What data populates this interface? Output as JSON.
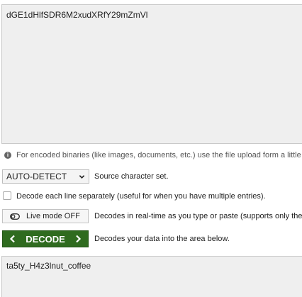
{
  "input": {
    "value": "dGE1dHlfSDR6M2xudXRfY29mZmVl"
  },
  "hint": {
    "icon": "info-icon",
    "text": "For encoded binaries (like images, documents, etc.) use the file upload form a little fu"
  },
  "charset": {
    "selected": "AUTO-DETECT",
    "label": "Source character set."
  },
  "each_line": {
    "checked": false,
    "label": "Decode each line separately (useful for when you have multiple entries)."
  },
  "live_mode": {
    "button_label": "Live mode OFF",
    "label": "Decodes in real-time as you type or paste (supports only the U"
  },
  "decode": {
    "button_label": "DECODE",
    "label": "Decodes your data into the area below.",
    "color": "#2f6b1f"
  },
  "output": {
    "value": "ta5ty_H4z3lnut_coffee"
  }
}
